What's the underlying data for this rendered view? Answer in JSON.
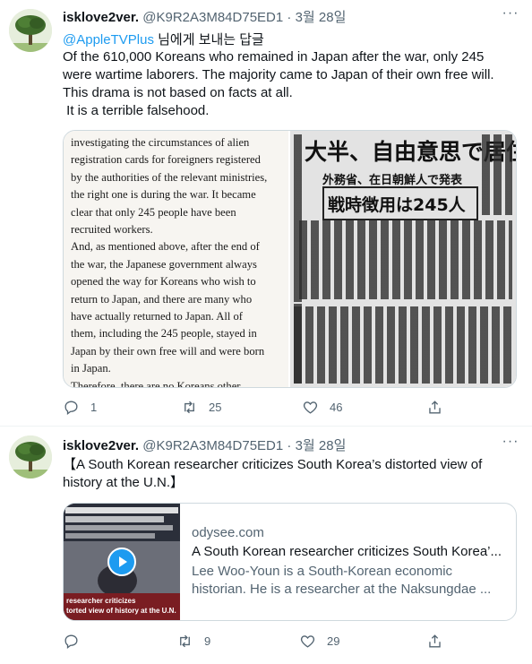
{
  "tweets": [
    {
      "user": {
        "name": "isklove2ver.",
        "handle": "@K9R2A3M84D75ED1",
        "separator": "·",
        "date": "3월 28일"
      },
      "reply_to": {
        "mention": "@AppleTVPlus",
        "suffix": " 님에게 보내는 답글"
      },
      "text": "Of the 610,000 Koreans who remained in Japan after the war, only 245\nwere wartime laborers. The majority came to Japan of their own free will.\nThis drama is not based on facts at all.\n It is a terrible falsehood.",
      "media": {
        "book_lines": [
          "investigating the circumstances of alien",
          "registration cards for foreigners registered",
          "by the authorities of the relevant ministries,",
          "the right one is during the war. It became",
          "clear that only 245 people have been",
          "recruited workers.",
          "    And, as mentioned above, after the end of",
          "the war, the Japanese government always",
          "opened the way for Koreans who wish to",
          "return to Japan, and there are many who",
          "have actually returned to Japan. All of",
          "them, including the 245 people, stayed in",
          "Japan by their own free will and were born",
          "in Japan.",
          "    Therefore, there are no Koreans other"
        ],
        "newspaper": {
          "headline": "大半、自由意思で居住",
          "subhead": "外務省、在日朝鮮人で発表",
          "boxed": "戦時徴用は245人"
        }
      },
      "actions": {
        "reply_icon": "reply-icon",
        "reply_count": "1",
        "retweet_icon": "retweet-icon",
        "retweet_count": "25",
        "like_icon": "heart-icon",
        "like_count": "46",
        "share_icon": "share-icon"
      }
    },
    {
      "user": {
        "name": "isklove2ver.",
        "handle": "@K9R2A3M84D75ED1",
        "separator": "·",
        "date": "3월 28일"
      },
      "text": "【A South Korean researcher criticizes South Korea’s distorted view of\nhistory at the U.N.】",
      "card": {
        "domain": "odysee.com",
        "title": "A South Korean researcher criticizes South Korea’...",
        "description": "Lee Woo-Youn is a South-Korean economic historian. He is a researcher at the Naksungdae ...",
        "thumb_caption_1": "researcher criticizes",
        "thumb_caption_2": "torted view of history at the U.N.",
        "play_icon": "play-icon"
      },
      "actions": {
        "reply_icon": "reply-icon",
        "reply_count": "",
        "retweet_icon": "retweet-icon",
        "retweet_count": "9",
        "like_icon": "heart-icon",
        "like_count": "29",
        "share_icon": "share-icon"
      }
    }
  ],
  "colors": {
    "link": "#1d9bf0",
    "secondary": "#536471",
    "border": "#cfd9de"
  }
}
